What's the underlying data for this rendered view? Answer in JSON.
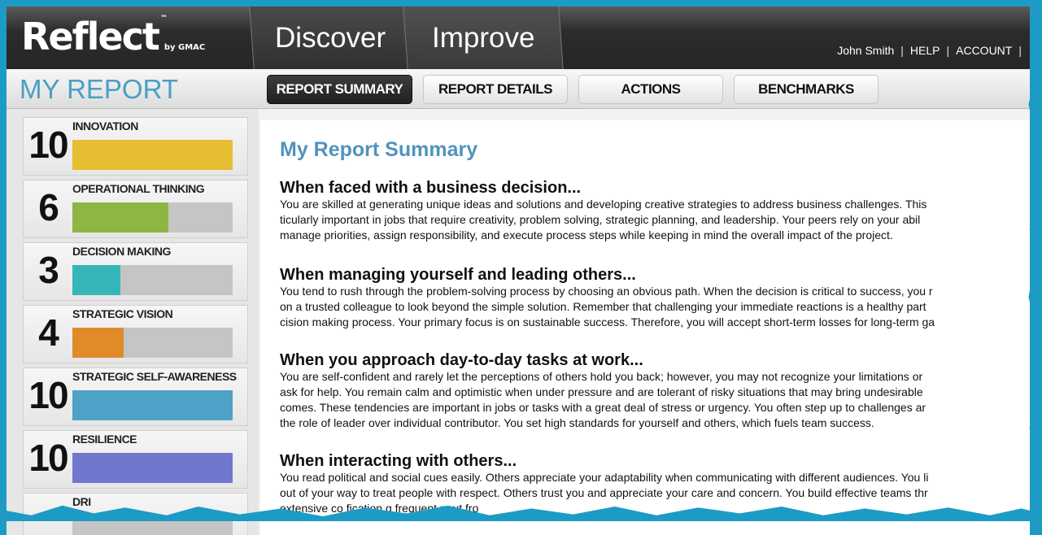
{
  "header": {
    "logo_text": "Reflect",
    "logo_tm": "™",
    "logo_by": "by GMAC",
    "tabs": [
      {
        "label": "Discover",
        "active": true
      },
      {
        "label": "Improve",
        "active": false
      }
    ],
    "user_name": "John Smith",
    "help_label": "HELP",
    "account_label": "ACCOUNT",
    "separator": "|"
  },
  "subnav": {
    "page_title": "MY REPORT",
    "tabs": [
      {
        "label": "REPORT SUMMARY",
        "active": true
      },
      {
        "label": "REPORT DETAILS",
        "active": false
      },
      {
        "label": "ACTIONS",
        "active": false
      },
      {
        "label": "BENCHMARKS",
        "active": false
      }
    ]
  },
  "metrics": [
    {
      "score": "10",
      "label": "INNOVATION",
      "fill_fraction": 1.0,
      "color": "#e7bd31"
    },
    {
      "score": "6",
      "label": "OPERATIONAL THINKING",
      "fill_fraction": 0.6,
      "color": "#8db642"
    },
    {
      "score": "3",
      "label": "DECISION MAKING",
      "fill_fraction": 0.3,
      "color": "#36b6b8"
    },
    {
      "score": "4",
      "label": "STRATEGIC VISION",
      "fill_fraction": 0.32,
      "color": "#e08a2a"
    },
    {
      "score": "10",
      "label": "STRATEGIC SELF-AWARENESS",
      "fill_fraction": 1.0,
      "color": "#4ea2c7"
    },
    {
      "score": "10",
      "label": "RESILIENCE",
      "fill_fraction": 1.0,
      "color": "#7077cc"
    },
    {
      "score": "",
      "label": "DRI",
      "fill_fraction": 0.0,
      "color": "#c5c5c5"
    }
  ],
  "main": {
    "title": "My Report Summary",
    "sections": [
      {
        "heading": "When faced with a business decision...",
        "lines": [
          "You are skilled at generating unique ideas and solutions and developing creative strategies to address business challenges. This",
          "ticularly important in jobs that require creativity, problem solving, strategic planning, and leadership. Your peers rely on your abil",
          "manage priorities, assign responsibility, and execute process steps while keeping in mind the overall impact of the project."
        ]
      },
      {
        "heading": "When managing yourself and leading others...",
        "lines": [
          "You tend to rush through the problem-solving process by choosing an obvious path. When the decision is critical to success, you r",
          "on a trusted colleague to look beyond the simple solution. Remember that challenging your immediate reactions is a healthy part",
          "cision making process. Your primary focus is on sustainable success. Therefore, you will accept short-term losses for long-term ga"
        ]
      },
      {
        "heading": "When you approach day-to-day tasks at work...",
        "lines": [
          "You are self-confident and rarely let the perceptions of others hold you back; however, you may not recognize your limitations or",
          "ask for help. You remain calm and optimistic when under pressure and are tolerant of risky situations that may bring undesirable",
          "comes. These tendencies are important in jobs or tasks with a great deal of stress or urgency. You often step up to challenges ar",
          "the role of leader over individual contributor. You set high standards for yourself and others, which fuels team success."
        ]
      },
      {
        "heading": "When interacting with others...",
        "lines": [
          "You read political and social cues easily. Others appreciate your adaptability when communicating with different audiences. You li",
          "out of your way to treat people with respect. Others trust you and appreciate your care and concern. You build effective teams thr",
          "extensive co        fication                 g frequent  nput fro"
        ]
      }
    ]
  }
}
